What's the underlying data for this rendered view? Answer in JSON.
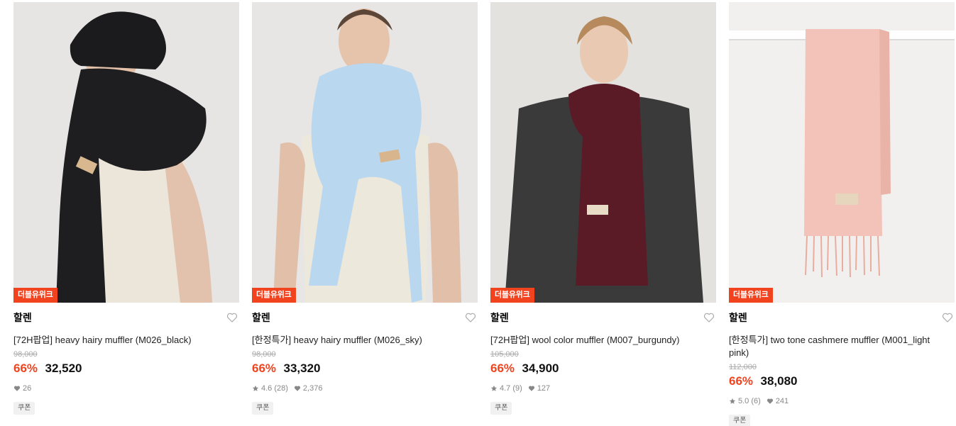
{
  "products": [
    {
      "badge": "더블유위크",
      "brand": "할렌",
      "name": "[72H팝업] heavy hairy muffler (M026_black)",
      "original_price": "98,000",
      "discount": "66%",
      "price": "32,520",
      "rating": "",
      "reviews": "",
      "likes": "26",
      "coupon": "쿠폰",
      "scarf_color": "#1e1e20"
    },
    {
      "badge": "더블유위크",
      "brand": "할렌",
      "name": "[한정특가] heavy hairy muffler (M026_sky)",
      "original_price": "98,000",
      "discount": "66%",
      "price": "33,320",
      "rating": "4.6",
      "reviews": "(28)",
      "likes": "2,376",
      "coupon": "쿠폰",
      "scarf_color": "#b9d7ef"
    },
    {
      "badge": "더블유위크",
      "brand": "할렌",
      "name": "[72H팝업] wool color muffler (M007_burgundy)",
      "original_price": "105,000",
      "discount": "66%",
      "price": "34,900",
      "rating": "4.7",
      "reviews": "(9)",
      "likes": "127",
      "coupon": "쿠폰",
      "scarf_color": "#5a1b26"
    },
    {
      "badge": "더블유위크",
      "brand": "할렌",
      "name": "[한정특가] two tone cashmere muffler (M001_light pink)",
      "original_price": "112,000",
      "discount": "66%",
      "price": "38,080",
      "rating": "5.0",
      "reviews": "(6)",
      "likes": "241",
      "coupon": "쿠폰",
      "scarf_color": "#f3c2b8"
    }
  ],
  "colors": {
    "accent": "#f0431e",
    "text_muted": "#888888"
  },
  "icons": {
    "wishlist": "heart-outline-icon",
    "rating": "star-icon",
    "likes": "heart-icon"
  }
}
